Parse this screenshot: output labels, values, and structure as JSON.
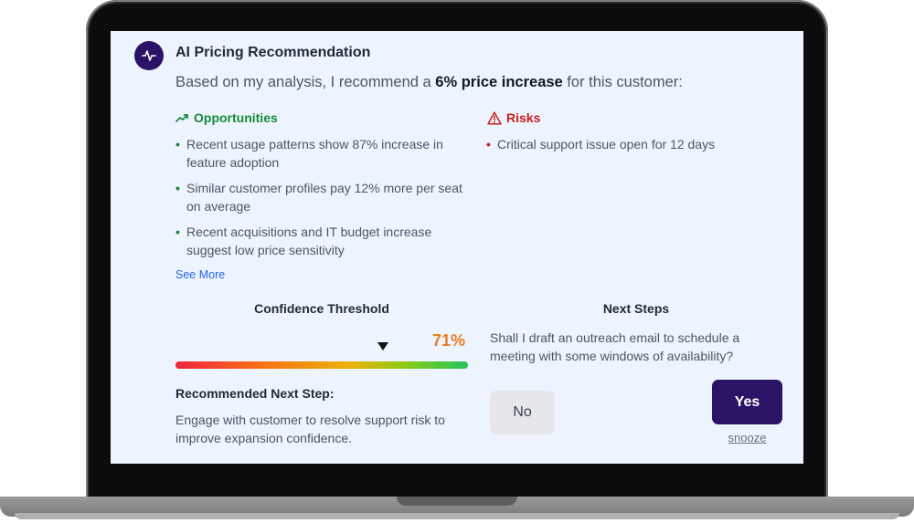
{
  "card": {
    "title": "AI Pricing Recommendation",
    "intro_before": "Based on my analysis, I recommend a ",
    "intro_bold": "6% price increase",
    "intro_after": " for this customer:",
    "avatar_icon": "activity-pulse-icon"
  },
  "opportunities": {
    "heading": "Opportunities",
    "icon": "trending-up-icon",
    "color": "#168a3e",
    "items": [
      {
        "text": "Recent usage patterns show 87% increase in feature adoption"
      },
      {
        "text": "Similar customer profiles pay 12% more per seat on average"
      },
      {
        "text": "Recent acquisitions and IT budget increase suggest low price sensitivity"
      }
    ],
    "see_more": "See More"
  },
  "risks": {
    "heading": "Risks",
    "icon": "warning-triangle-icon",
    "color": "#c81e1e",
    "items": [
      {
        "text": "Critical support issue open for 12 days"
      }
    ]
  },
  "confidence": {
    "title": "Confidence Threshold",
    "value_label": "71%",
    "marker_fraction": 0.71,
    "color": "#e67e22"
  },
  "recommended": {
    "title": "Recommended Next Step:",
    "text": "Engage with customer to resolve support risk to improve expansion confidence."
  },
  "next_steps": {
    "title": "Next Steps",
    "prompt": "Shall I draft an outreach email to schedule a meeting with some windows of availability?",
    "no_label": "No",
    "yes_label": "Yes",
    "snooze_label": "snooze",
    "accent": "#2b1465"
  }
}
